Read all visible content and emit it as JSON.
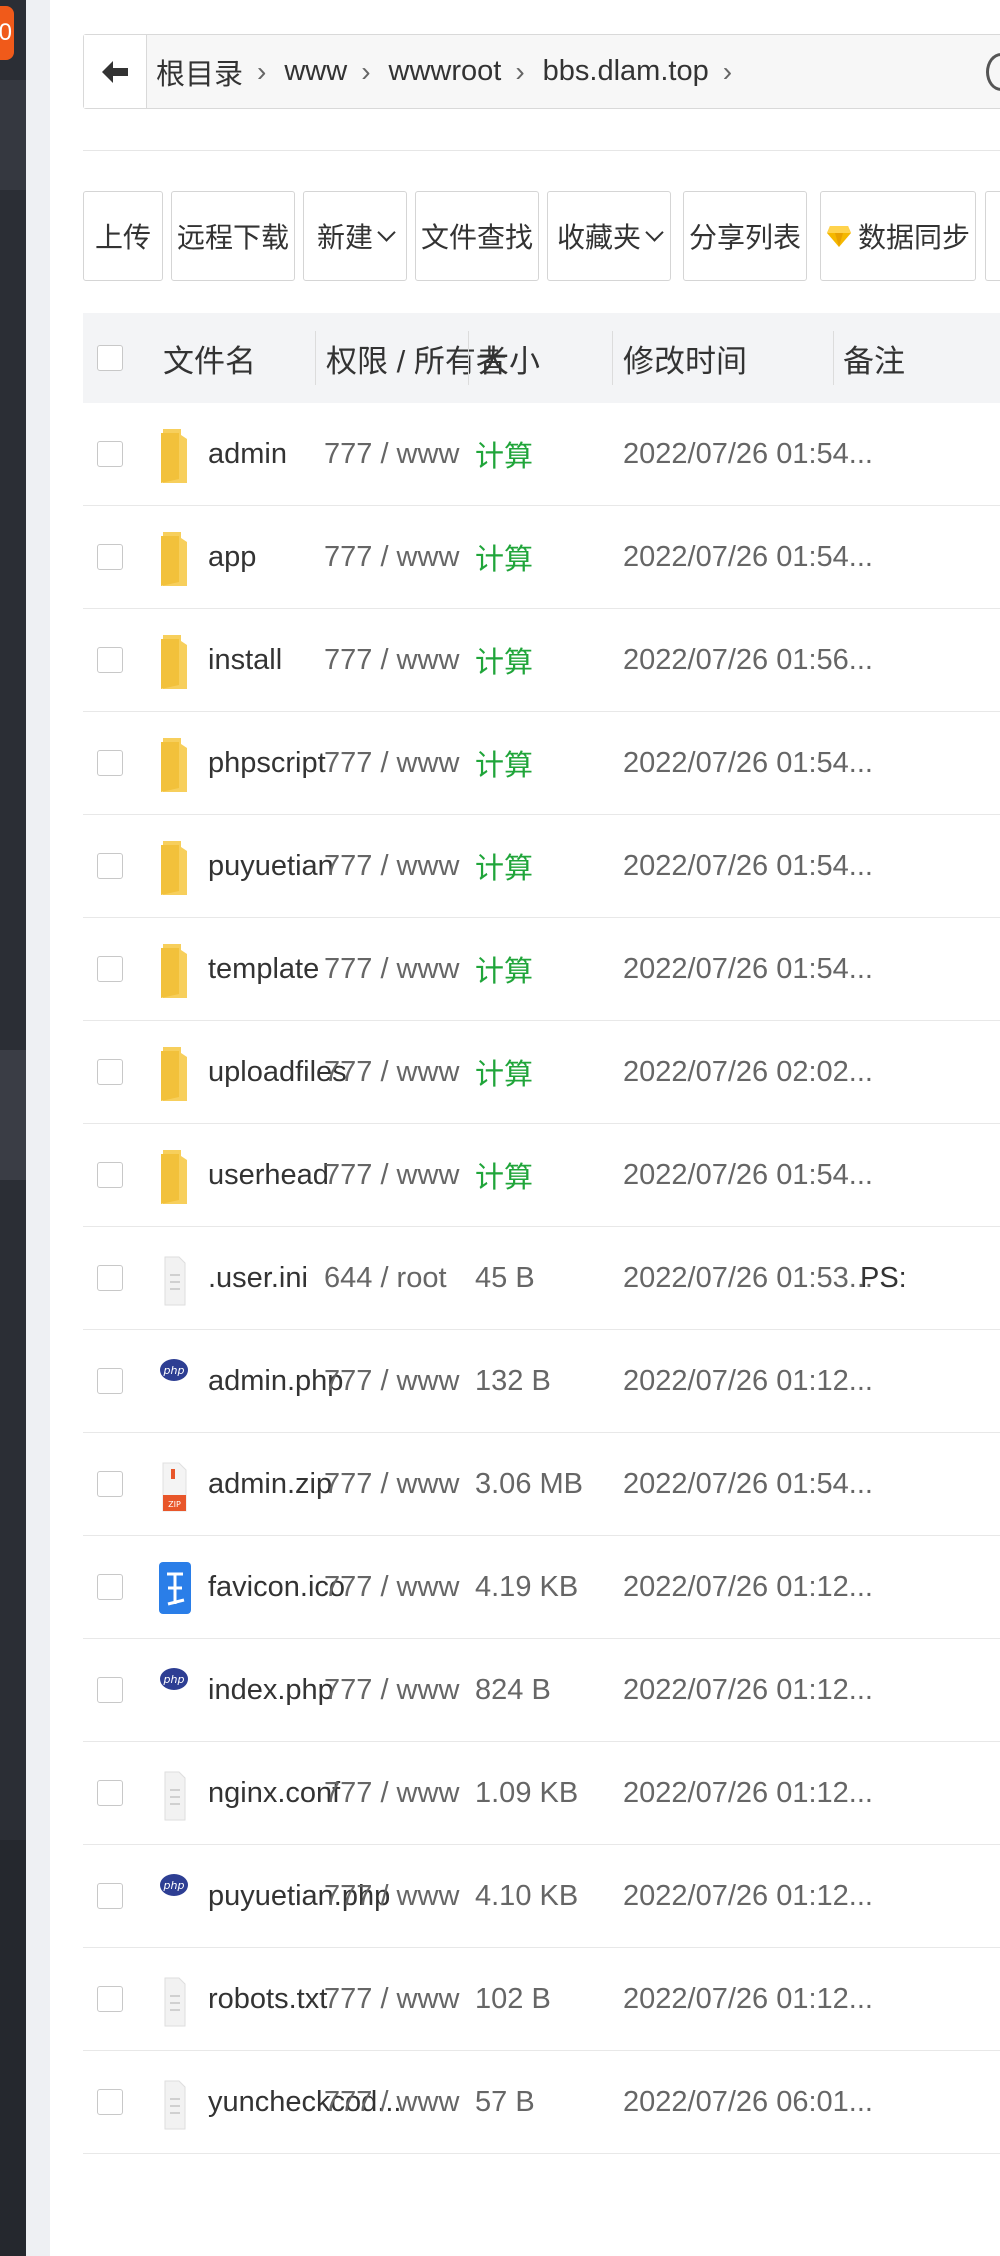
{
  "sidebar": {
    "badge_text": "0"
  },
  "breadcrumb": {
    "items": [
      "根目录",
      "www",
      "wwwroot",
      "bbs.dlam.top"
    ],
    "separator": "›"
  },
  "toolbar": {
    "buttons": [
      {
        "label": "上传",
        "dropdown": false
      },
      {
        "label": "远程下载",
        "dropdown": false
      },
      {
        "label": "新建",
        "dropdown": true
      },
      {
        "label": "文件查找",
        "dropdown": false
      },
      {
        "label": "收藏夹",
        "dropdown": true
      },
      {
        "label": "分享列表",
        "dropdown": false
      },
      {
        "label": "数据同步",
        "dropdown": false,
        "icon": "gem-icon"
      }
    ]
  },
  "table": {
    "columns": [
      "文件名",
      "权限 / 所有者",
      "大小",
      "修改时间",
      "备注"
    ],
    "rows": [
      {
        "name": "admin",
        "type": "folder",
        "perm": "777 / www",
        "size": "计算",
        "mtime": "2022/07/26 01:54...",
        "note": ""
      },
      {
        "name": "app",
        "type": "folder",
        "perm": "777 / www",
        "size": "计算",
        "mtime": "2022/07/26 01:54...",
        "note": ""
      },
      {
        "name": "install",
        "type": "folder",
        "perm": "777 / www",
        "size": "计算",
        "mtime": "2022/07/26 01:56...",
        "note": ""
      },
      {
        "name": "phpscript",
        "type": "folder",
        "perm": "777 / www",
        "size": "计算",
        "mtime": "2022/07/26 01:54...",
        "note": ""
      },
      {
        "name": "puyuetian",
        "type": "folder",
        "perm": "777 / www",
        "size": "计算",
        "mtime": "2022/07/26 01:54...",
        "note": ""
      },
      {
        "name": "template",
        "type": "folder",
        "perm": "777 / www",
        "size": "计算",
        "mtime": "2022/07/26 01:54...",
        "note": ""
      },
      {
        "name": "uploadfiles",
        "type": "folder",
        "perm": "777 / www",
        "size": "计算",
        "mtime": "2022/07/26 02:02...",
        "note": ""
      },
      {
        "name": "userhead",
        "type": "folder",
        "perm": "777 / www",
        "size": "计算",
        "mtime": "2022/07/26 01:54...",
        "note": ""
      },
      {
        "name": ".user.ini",
        "type": "text",
        "perm": "644 / root",
        "size": "45 B",
        "mtime": "2022/07/26 01:53...",
        "note": "PS:"
      },
      {
        "name": "admin.php",
        "type": "php",
        "perm": "777 / www",
        "size": "132 B",
        "mtime": "2022/07/26 01:12...",
        "note": ""
      },
      {
        "name": "admin.zip",
        "type": "zip",
        "perm": "777 / www",
        "size": "3.06 MB",
        "mtime": "2022/07/26 01:54...",
        "note": ""
      },
      {
        "name": "favicon.ico",
        "type": "ico",
        "perm": "777 / www",
        "size": "4.19 KB",
        "mtime": "2022/07/26 01:12...",
        "note": ""
      },
      {
        "name": "index.php",
        "type": "php",
        "perm": "777 / www",
        "size": "824 B",
        "mtime": "2022/07/26 01:12...",
        "note": ""
      },
      {
        "name": "nginx.conf",
        "type": "text",
        "perm": "777 / www",
        "size": "1.09 KB",
        "mtime": "2022/07/26 01:12...",
        "note": ""
      },
      {
        "name": "puyuetian.php",
        "type": "php",
        "perm": "777 / www",
        "size": "4.10 KB",
        "mtime": "2022/07/26 01:12...",
        "note": ""
      },
      {
        "name": "robots.txt",
        "type": "text",
        "perm": "777 / www",
        "size": "102 B",
        "mtime": "2022/07/26 01:12...",
        "note": ""
      },
      {
        "name": "yuncheckcod...",
        "type": "text",
        "perm": "777 / www",
        "size": "57 B",
        "mtime": "2022/07/26 06:01...",
        "note": ""
      }
    ]
  },
  "icons": {
    "folder": "folder-icon",
    "text": "text-file-icon",
    "php": "php-file-icon",
    "zip": "zip-file-icon",
    "ico": "ico-file-icon"
  },
  "colors": {
    "calc_green": "#20a53a",
    "folder_yellow": "#f7cf5c",
    "php_blue": "#2d3e93",
    "zip_orange": "#e8562a",
    "ico_blue": "#2a7ee8",
    "sidebar_dark": "#2b2e35",
    "badge_orange": "#f05a1a"
  }
}
